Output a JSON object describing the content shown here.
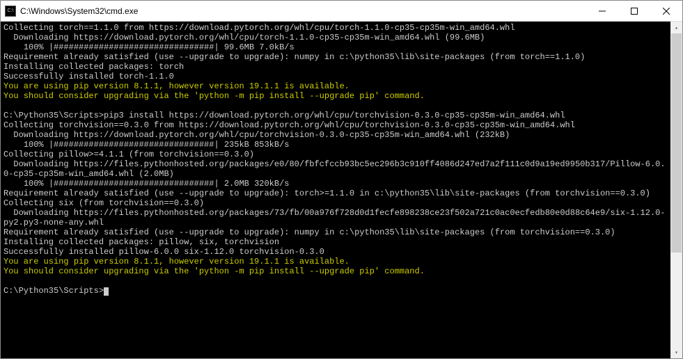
{
  "window": {
    "icon_label": "C:\\",
    "title": "C:\\Windows\\System32\\cmd.exe"
  },
  "lines": [
    {
      "cls": "",
      "text": "Collecting torch==1.1.0 from https://download.pytorch.org/whl/cpu/torch-1.1.0-cp35-cp35m-win_amd64.whl"
    },
    {
      "cls": "",
      "text": "  Downloading https://download.pytorch.org/whl/cpu/torch-1.1.0-cp35-cp35m-win_amd64.whl (99.6MB)"
    },
    {
      "cls": "",
      "text": "    100% |################################| 99.6MB 7.0kB/s"
    },
    {
      "cls": "",
      "text": "Requirement already satisfied (use --upgrade to upgrade): numpy in c:\\python35\\lib\\site-packages (from torch==1.1.0)"
    },
    {
      "cls": "",
      "text": "Installing collected packages: torch"
    },
    {
      "cls": "",
      "text": "Successfully installed torch-1.1.0"
    },
    {
      "cls": "yellow",
      "text": "You are using pip version 8.1.1, however version 19.1.1 is available."
    },
    {
      "cls": "yellow",
      "text": "You should consider upgrading via the 'python -m pip install --upgrade pip' command."
    },
    {
      "cls": "",
      "text": ""
    },
    {
      "cls": "",
      "text": "C:\\Python35\\Scripts>pip3 install https://download.pytorch.org/whl/cpu/torchvision-0.3.0-cp35-cp35m-win_amd64.whl"
    },
    {
      "cls": "",
      "text": "Collecting torchvision==0.3.0 from https://download.pytorch.org/whl/cpu/torchvision-0.3.0-cp35-cp35m-win_amd64.whl"
    },
    {
      "cls": "",
      "text": "  Downloading https://download.pytorch.org/whl/cpu/torchvision-0.3.0-cp35-cp35m-win_amd64.whl (232kB)"
    },
    {
      "cls": "",
      "text": "    100% |################################| 235kB 853kB/s"
    },
    {
      "cls": "",
      "text": "Collecting pillow>=4.1.1 (from torchvision==0.3.0)"
    },
    {
      "cls": "",
      "text": "  Downloading https://files.pythonhosted.org/packages/e0/80/fbfcfccb93bc5ec296b3c910ff4086d247ed7a2f111c0d9a19ed9950b317/Pillow-6.0.0-cp35-cp35m-win_amd64.whl (2.0MB)"
    },
    {
      "cls": "",
      "text": "    100% |################################| 2.0MB 320kB/s"
    },
    {
      "cls": "",
      "text": "Requirement already satisfied (use --upgrade to upgrade): torch>=1.1.0 in c:\\python35\\lib\\site-packages (from torchvision==0.3.0)"
    },
    {
      "cls": "",
      "text": "Collecting six (from torchvision==0.3.0)"
    },
    {
      "cls": "",
      "text": "  Downloading https://files.pythonhosted.org/packages/73/fb/00a976f728d0d1fecfe898238ce23f502a721c0ac0ecfedb80e0d88c64e9/six-1.12.0-py2.py3-none-any.whl"
    },
    {
      "cls": "",
      "text": "Requirement already satisfied (use --upgrade to upgrade): numpy in c:\\python35\\lib\\site-packages (from torchvision==0.3.0)"
    },
    {
      "cls": "",
      "text": "Installing collected packages: pillow, six, torchvision"
    },
    {
      "cls": "",
      "text": "Successfully installed pillow-6.0.0 six-1.12.0 torchvision-0.3.0"
    },
    {
      "cls": "yellow",
      "text": "You are using pip version 8.1.1, however version 19.1.1 is available."
    },
    {
      "cls": "yellow",
      "text": "You should consider upgrading via the 'python -m pip install --upgrade pip' command."
    },
    {
      "cls": "",
      "text": ""
    }
  ],
  "prompt": "C:\\Python35\\Scripts>"
}
